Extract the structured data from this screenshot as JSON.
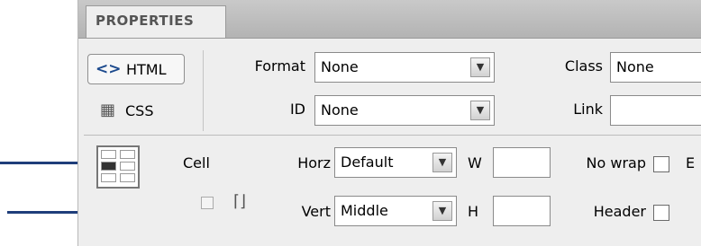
{
  "panel": {
    "tab_title": "PROPERTIES",
    "html_button": {
      "icon": "code-brackets-icon",
      "label": "HTML"
    },
    "css_button": {
      "icon": "css-icon",
      "label": "CSS"
    },
    "format": {
      "label": "Format",
      "value": "None"
    },
    "id": {
      "label": "ID",
      "value": "None"
    },
    "class": {
      "label": "Class",
      "value": "None"
    },
    "link": {
      "label": "Link",
      "value": ""
    },
    "cell": {
      "label": "Cell",
      "horz": {
        "label": "Horz",
        "value": "Default"
      },
      "vert": {
        "label": "Vert",
        "value": "Middle"
      },
      "w": {
        "label": "W",
        "value": ""
      },
      "h": {
        "label": "H",
        "value": ""
      },
      "nowrap": {
        "label": "No wrap",
        "checked": false
      },
      "header": {
        "label": "Header",
        "checked": false
      },
      "truncated_label": "E"
    }
  },
  "annotations": {
    "arrow_color": "#1f3e7a"
  }
}
